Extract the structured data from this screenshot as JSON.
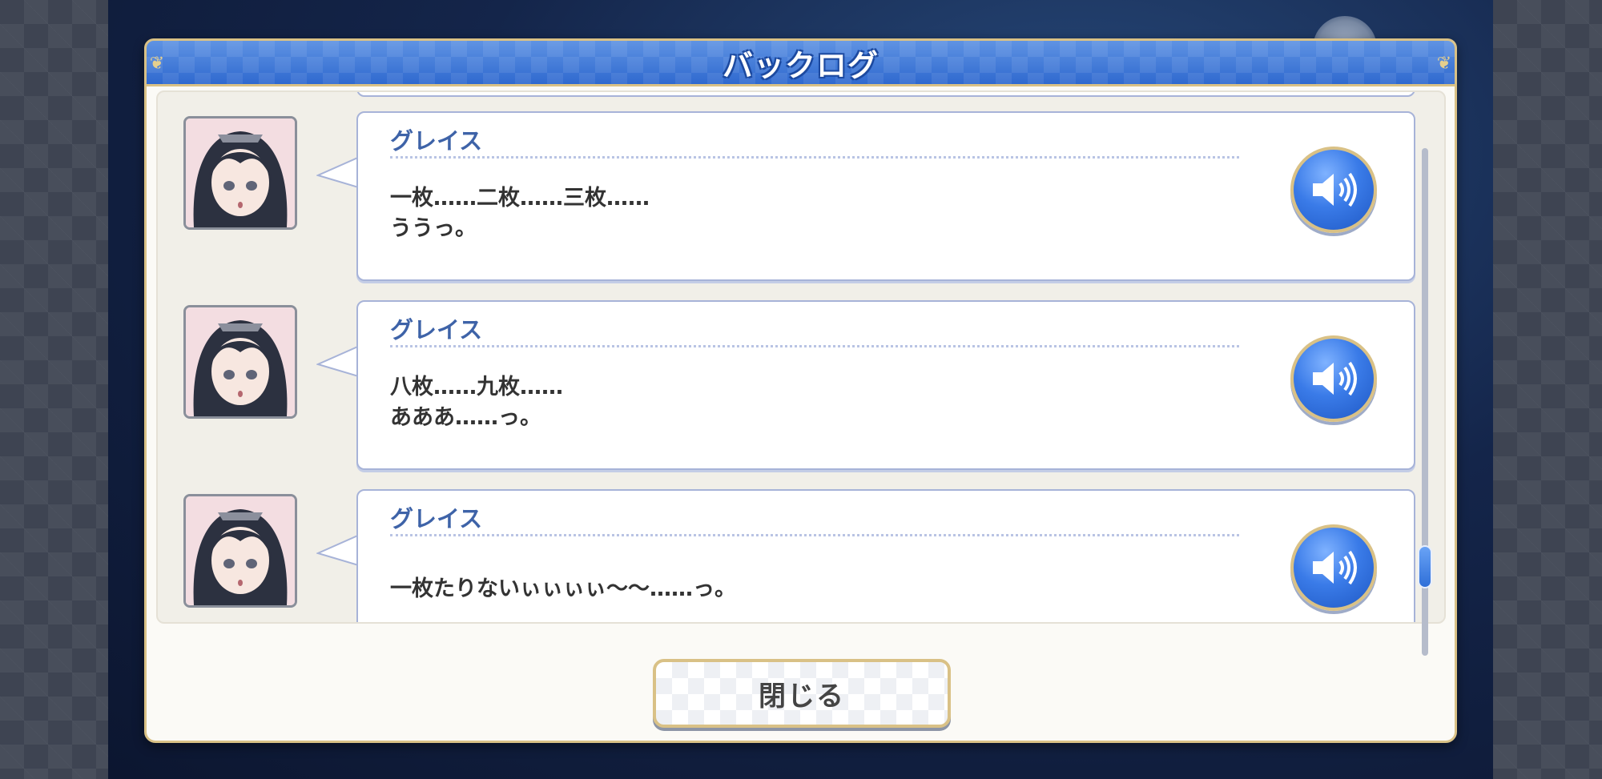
{
  "dialog": {
    "title": "バックログ",
    "close_label": "閉じる"
  },
  "entries": [
    {
      "speaker": "グレイス",
      "line1": "一枚……二枚……三枚……",
      "line2": "ううっ。",
      "voice_icon": "speaker-icon"
    },
    {
      "speaker": "グレイス",
      "line1": "八枚……九枚……",
      "line2": "あああ……っ。",
      "voice_icon": "speaker-icon"
    },
    {
      "speaker": "グレイス",
      "line1": "一枚たりないぃぃぃぃ〜〜……っ。",
      "line2": "",
      "voice_icon": "speaker-icon"
    }
  ],
  "colors": {
    "title_bar": "#2f69cf",
    "frame_gold": "#d9c186",
    "speaker_name": "#3e63a8",
    "voice_button": "#3a7be8"
  }
}
